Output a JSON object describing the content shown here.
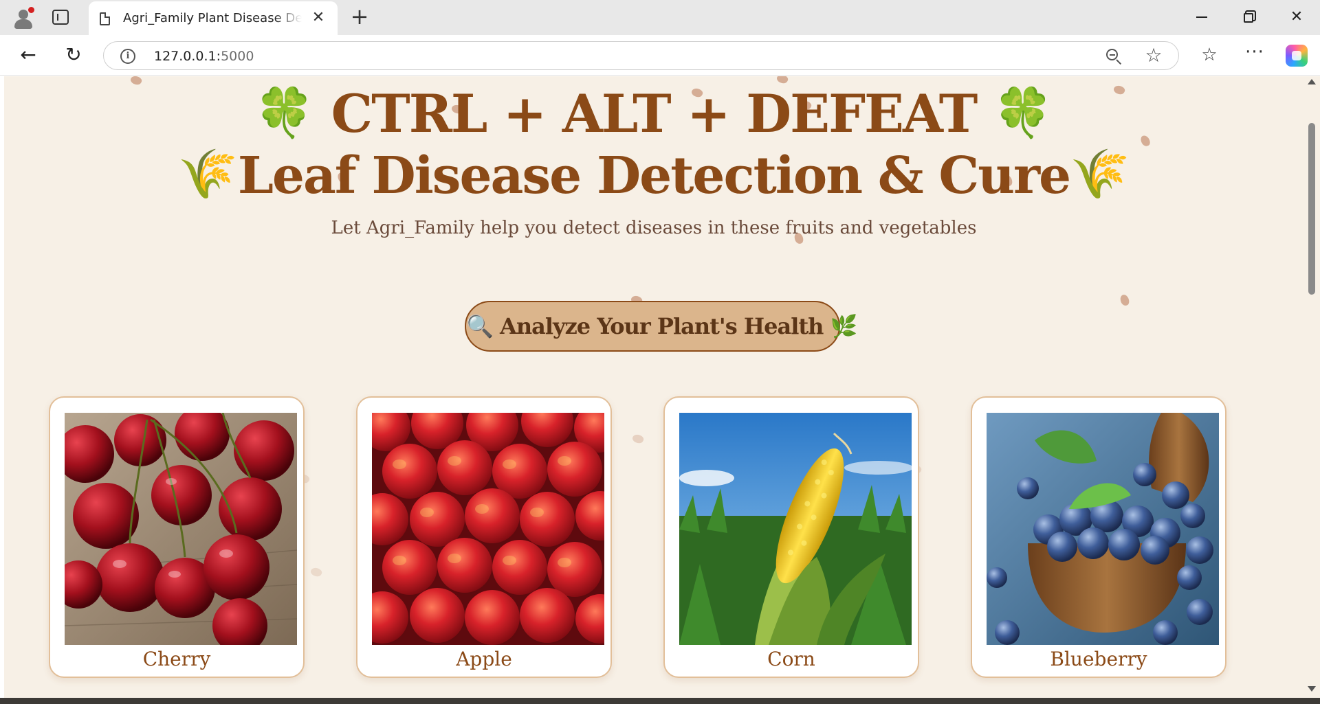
{
  "browser": {
    "tab_title": "Agri_Family Plant Disease Detection",
    "tab_close_glyph": "✕",
    "new_tab_glyph": "+",
    "url_host": "127.0.0.1:",
    "url_port": "5000",
    "info_glyph": "i",
    "star_glyph": "☆",
    "favorites_glyph": "☆",
    "more_glyph": "···",
    "back_glyph": "←",
    "reload_glyph": "↻",
    "close_glyph": "✕",
    "icons": [
      "profile-icon",
      "tab-actions-icon",
      "page-favicon-icon",
      "info-icon",
      "zoom-out-icon",
      "star-icon",
      "favorites-icon",
      "more-icon",
      "copilot-icon"
    ]
  },
  "header": {
    "title_line1": "CTRL + ALT + DEFEAT",
    "title_line1_emoji": "🍀",
    "title_line2": "Leaf Disease Detection & Cure",
    "title_line2_emoji": "🌾",
    "subtitle": "Let Agri_Family help you detect diseases in these fruits and vegetables"
  },
  "cta": {
    "label": "🔍 Analyze Your Plant's Health 🌿"
  },
  "cards": [
    {
      "label": "Cherry",
      "image": "cherries photo"
    },
    {
      "label": "Apple",
      "image": "red apples photo"
    },
    {
      "label": "Corn",
      "image": "corn cob in field photo"
    },
    {
      "label": "Blueberry",
      "image": "blueberries in wooden bowl photo"
    }
  ],
  "colors": {
    "page_bg": "#f7f0e6",
    "title_brown": "#8b4a17",
    "button_bg": "#dbb58c",
    "card_border": "#e2bf99"
  }
}
